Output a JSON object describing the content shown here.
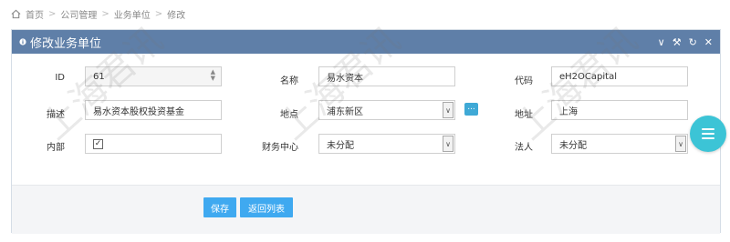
{
  "breadcrumb": {
    "items": [
      "首页",
      "公司管理",
      "业务单位",
      "修改"
    ]
  },
  "panel": {
    "title": "修改业务单位"
  },
  "form": {
    "id": {
      "label": "ID",
      "value": "61"
    },
    "name": {
      "label": "名称",
      "value": "易水资本"
    },
    "code": {
      "label": "代码",
      "value": "eH2OCapital"
    },
    "description": {
      "label": "描述",
      "value": "易水资本股权投资基金"
    },
    "location": {
      "label": "地点",
      "value": "浦东新区"
    },
    "address": {
      "label": "地址",
      "value": "上海"
    },
    "internal": {
      "label": "内部",
      "checked": true
    },
    "finance_center": {
      "label": "财务中心",
      "value": "未分配"
    },
    "legal_person": {
      "label": "法人",
      "value": "未分配"
    },
    "ellipsis_label": "..."
  },
  "buttons": {
    "save": "保存",
    "back": "返回列表"
  },
  "watermark_text": "上海君讯",
  "colors": {
    "header": "#5f7fa8",
    "button": "#3fa9f0",
    "fab": "#3cc4d6"
  }
}
